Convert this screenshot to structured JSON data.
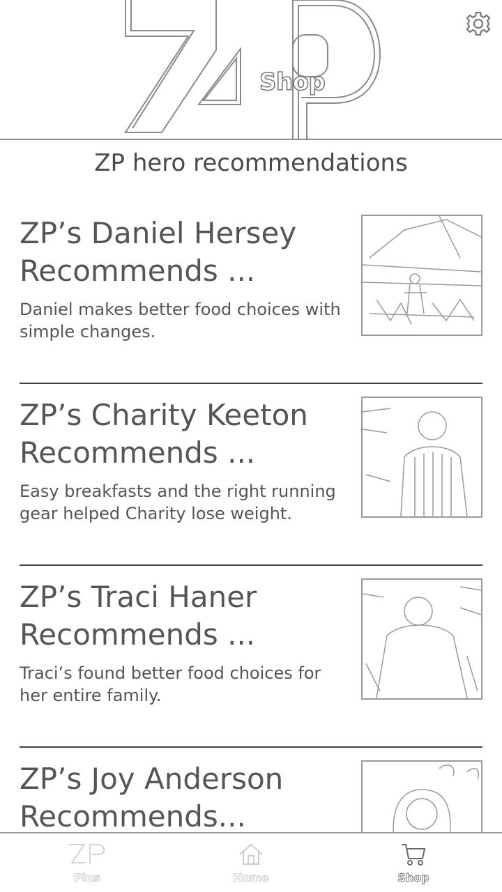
{
  "header": {
    "logo_shop_label": "Shop"
  },
  "section_title": "ZP hero recommendations",
  "cards": [
    {
      "title_line1": "ZP’s Daniel Hersey",
      "title_line2": "Recommends ...",
      "description": "Daniel makes better food choices with simple changes."
    },
    {
      "title_line1": "ZP’s Charity Keeton",
      "title_line2": "Recommends ...",
      "description": "Easy breakfasts and the right running gear helped Charity lose weight."
    },
    {
      "title_line1": "ZP’s Traci Haner",
      "title_line2": "Recommends ...",
      "description": "Traci’s found better food choices for her entire family."
    },
    {
      "title_line1": "ZP’s Joy Anderson",
      "title_line2": "Recommends...",
      "description": ""
    }
  ],
  "bottom_nav": {
    "items": [
      {
        "label": "Plus",
        "icon": "zp-logo-icon",
        "active": false
      },
      {
        "label": "Home",
        "icon": "home-icon",
        "active": false
      },
      {
        "label": "Shop",
        "icon": "cart-icon",
        "active": true
      }
    ]
  },
  "colors": {
    "text": "#555555",
    "divider": "#444444",
    "outline": "#8a8a8a"
  }
}
